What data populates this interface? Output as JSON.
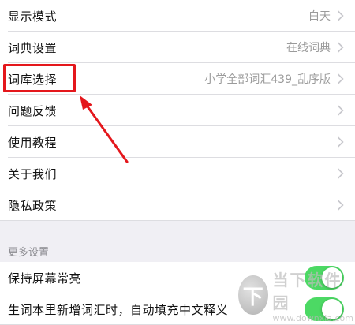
{
  "settings": {
    "items": [
      {
        "label": "显示模式",
        "value": "白天"
      },
      {
        "label": "词典设置",
        "value": "在线词典"
      },
      {
        "label": "词库选择",
        "value": "小学全部词汇439_乱序版"
      },
      {
        "label": "问题反馈",
        "value": ""
      },
      {
        "label": "使用教程",
        "value": ""
      },
      {
        "label": "关于我们",
        "value": ""
      },
      {
        "label": "隐私政策",
        "value": ""
      }
    ]
  },
  "more": {
    "header": "更多设置",
    "items": [
      {
        "label": "保持屏幕常亮",
        "enabled": true
      },
      {
        "label": "生词本里新增词汇时，自动填充中文释义",
        "enabled": true
      }
    ]
  },
  "annotation": {
    "highlight_color": "#e4171c"
  },
  "toggle_on_color": "#4cd964",
  "watermark": {
    "logo_glyph": "下",
    "cn": "当下软件园",
    "en": "www.downxia.com"
  }
}
